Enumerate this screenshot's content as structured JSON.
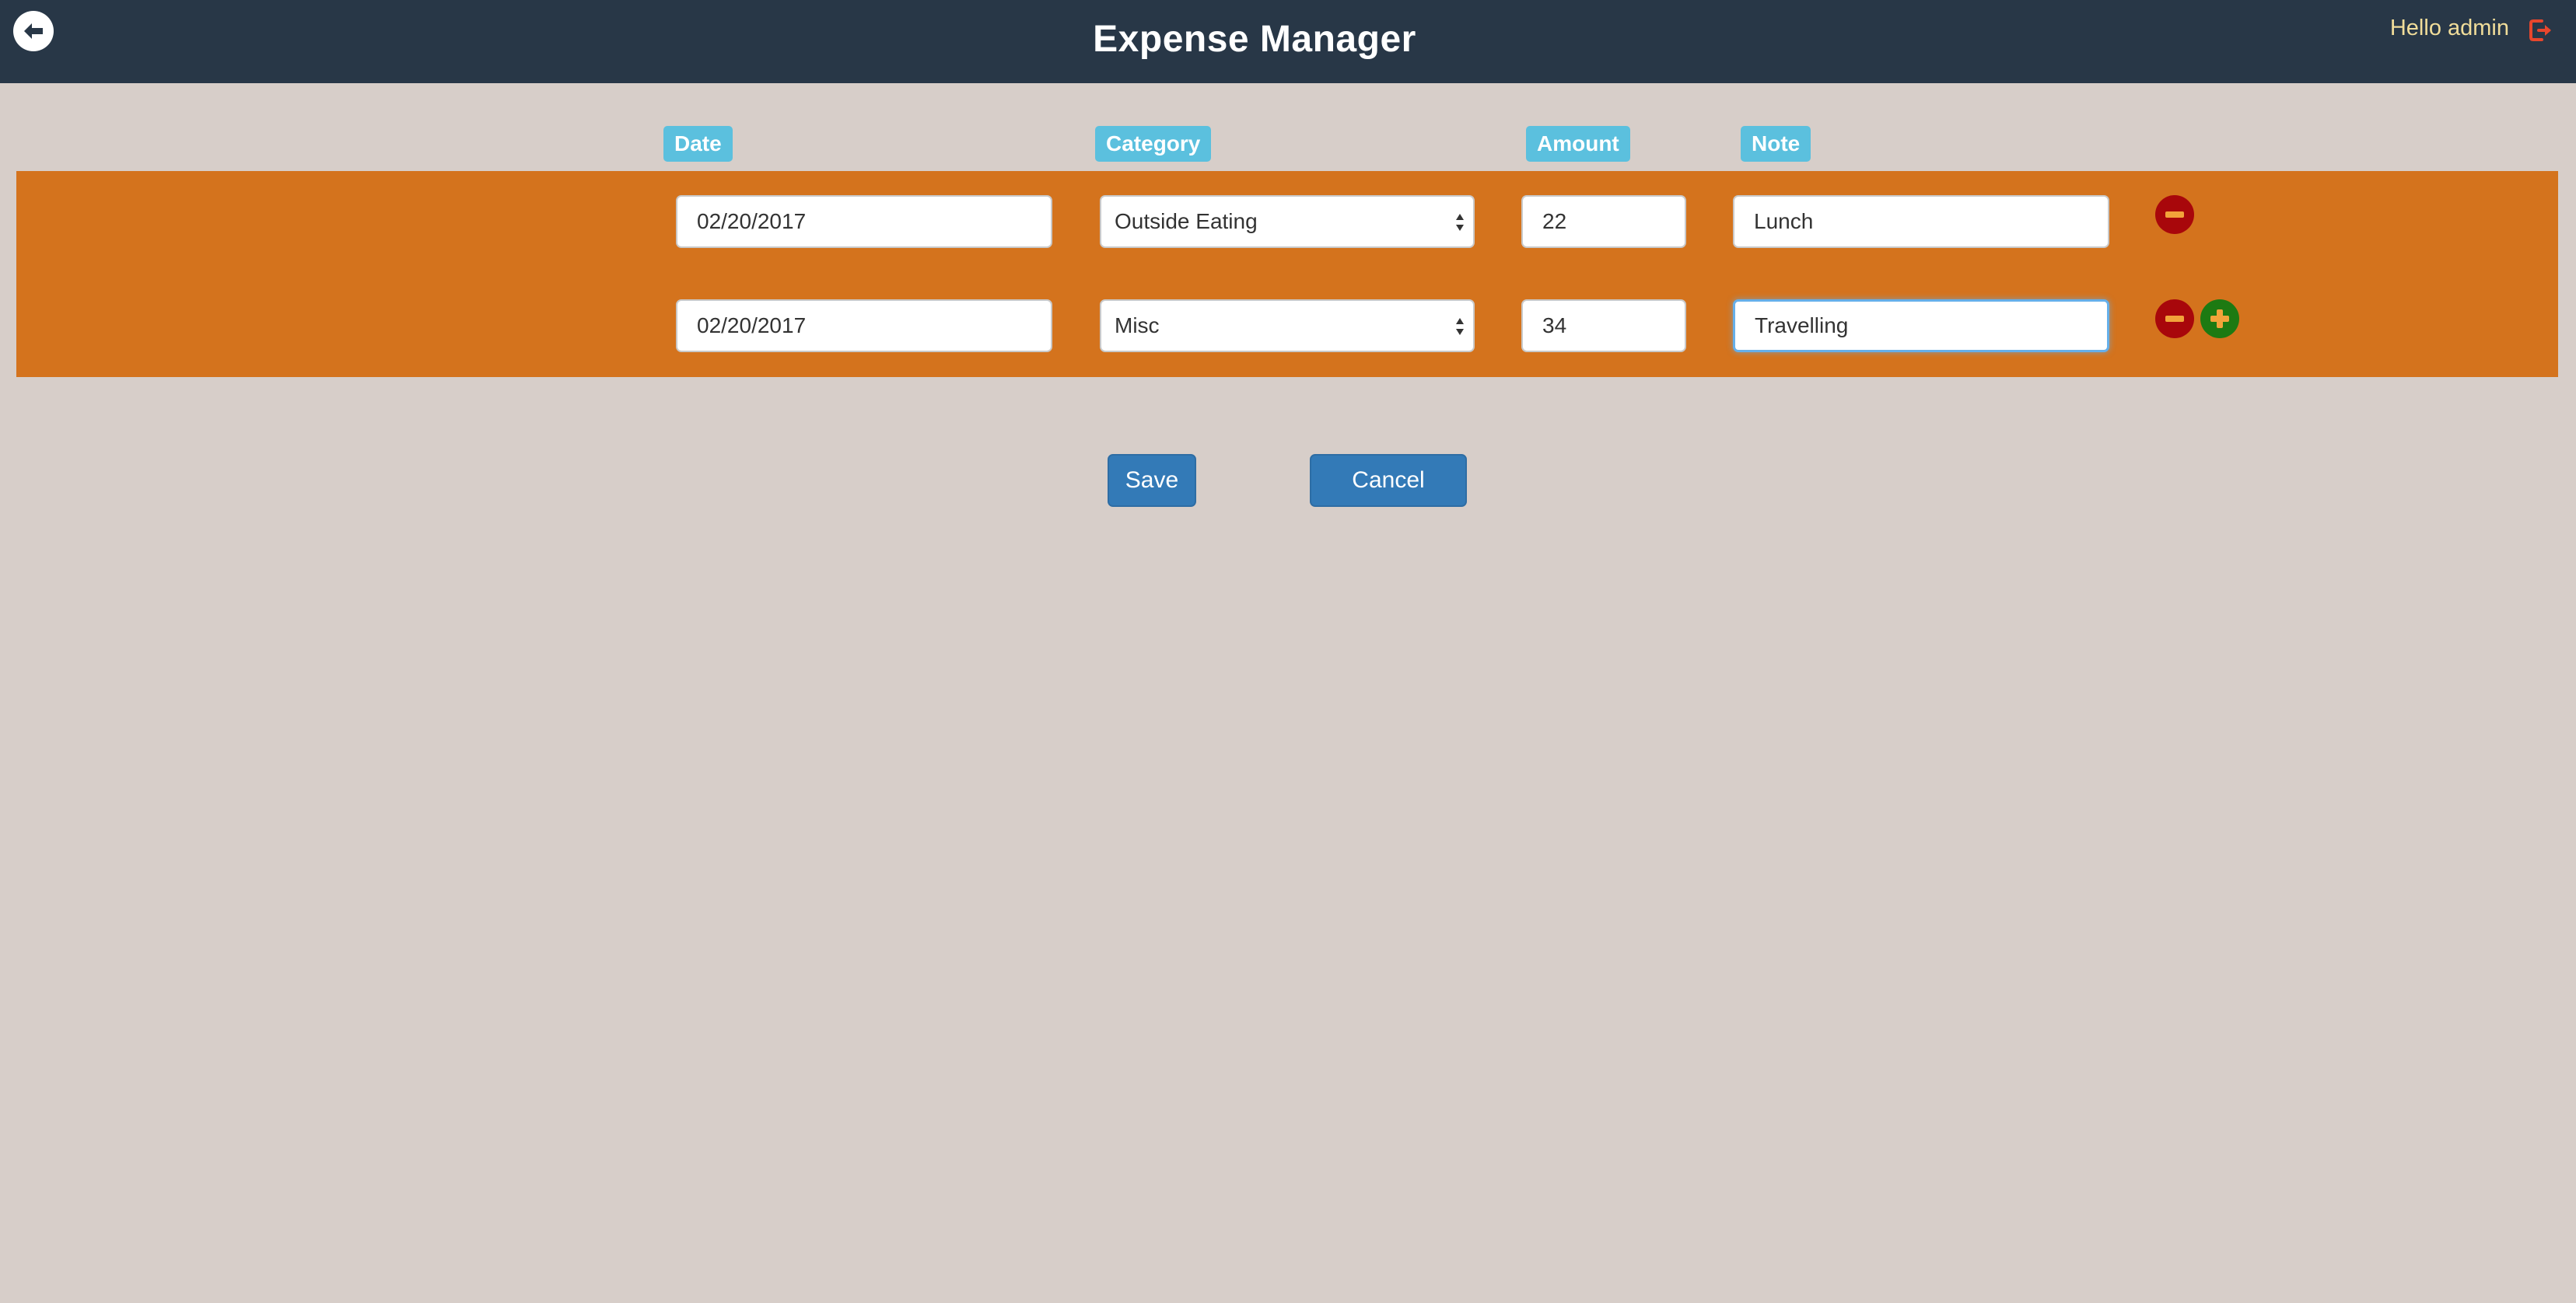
{
  "header": {
    "title": "Expense Manager",
    "greeting": "Hello admin",
    "back_icon": "arrow-left-icon",
    "logout_icon": "sign-out-icon"
  },
  "columns": [
    "Date",
    "Category",
    "Amount",
    "Note"
  ],
  "rows": [
    {
      "date": "02/20/2017",
      "category": "Outside Eating",
      "amount": "22",
      "note": "Lunch"
    },
    {
      "date": "02/20/2017",
      "category": "Misc",
      "amount": "34",
      "note": "Travelling"
    }
  ],
  "actions": {
    "save_label": "Save",
    "cancel_label": "Cancel"
  },
  "colors": {
    "header_bg": "#283747",
    "page_bg": "#d7cec9",
    "band_bg": "#d4731d",
    "label_bg": "#5bc0de",
    "primary_button": "#337ab7",
    "remove_button": "#a8070b",
    "add_button": "#1d7a12"
  }
}
